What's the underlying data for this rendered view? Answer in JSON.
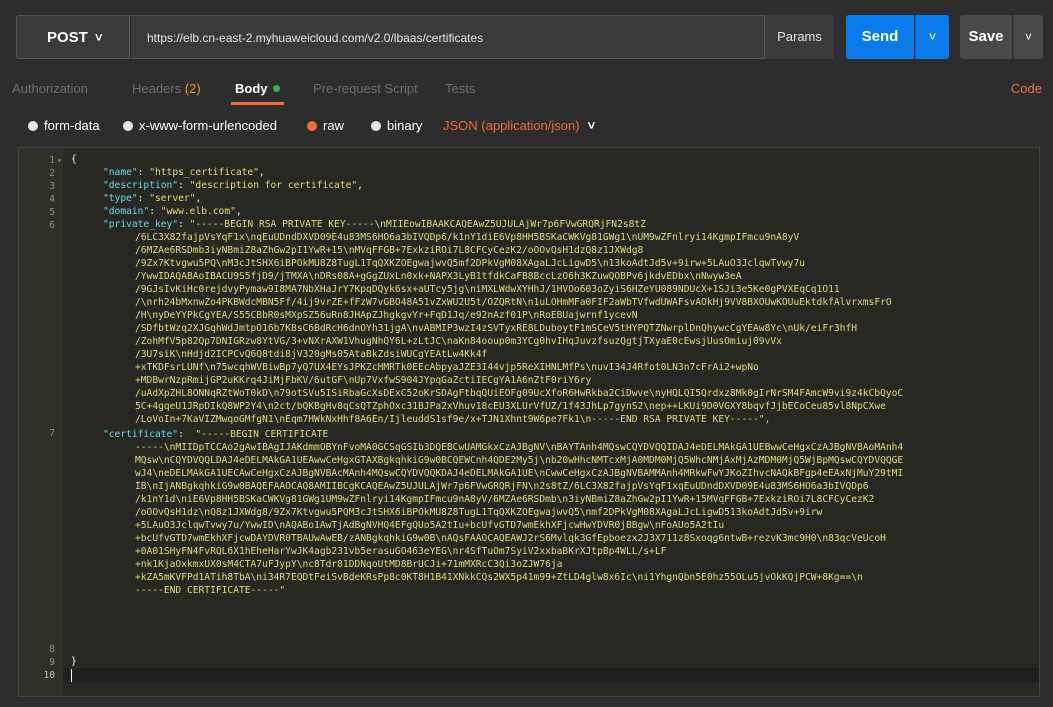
{
  "request": {
    "method": "POST",
    "url": "https://elb.cn-east-2.myhuaweicloud.com/v2.0/lbaas/certificates",
    "params_label": "Params",
    "send_label": "Send",
    "save_label": "Save"
  },
  "tabs": {
    "authorization": "Authorization",
    "headers": "Headers",
    "headers_count": "(2)",
    "body": "Body",
    "prerequest": "Pre-request Script",
    "tests": "Tests",
    "code": "Code"
  },
  "body_types": {
    "form_data": "form-data",
    "urlencoded": "x-www-form-urlencoded",
    "raw": "raw",
    "binary": "binary",
    "content_type": "JSON (application/json)"
  },
  "editor": {
    "line_numbers": [
      "1",
      "2",
      "3",
      "4",
      "5",
      "6",
      "7",
      "8",
      "9",
      "10"
    ],
    "open_brace": "{",
    "close_brace": "}",
    "name_key": "\"name\"",
    "name_val": "\"https_certificate\"",
    "desc_key": "\"description\"",
    "desc_val": "\"description for certificate\"",
    "type_key": "\"type\"",
    "type_val": "\"server\"",
    "domain_key": "\"domain\"",
    "domain_val": "\"www.elb.com\"",
    "pk_key": "\"private_key\"",
    "pk_lines": [
      "\"-----BEGIN RSA PRIVATE KEY-----\\nMIIEowIBAAKCAQEAwZ5UJULAjWr7p6FVwGRQRjFN2s8tZ",
      "/6LC3X82fajpVsYqF1x\\nqEuUDndDXVD09E4u83MS6HO6a3bIVQDp6/k1nY1diE6Vp8HH5BSKaCWKVg81GWg1\\nUM9wZFnlryi14KgmpIFmcu9nA8yV",
      "/6MZAe6RSDmb3iyNBmiZ8aZhGw2pI1YwR+15\\nMVqFFGB+7ExkziROi7L8CFCyCezK2/oOOvQsH1dzQ8z1JXWdg8",
      "/9Zx7Ktvgwu5PQ\\nM3cJtSHX6iBPOkMU8Z8TugL1TqQXKZOEgwajwvQ5mf2DPkVgM08XAgaLJcLigwD5\\n13koAdtJd5v+9irw+5LAuO3JclqwTvwy7u",
      "/YwwIDAQABAoIBACU9S5fjD9/jTMXA\\nDRs08A+gGgZUxLn0xk+NAPX3LyB1tfdkCaFB8BccLzO6h3KZuwQOBPv6jkdvEDbx\\nNwyw3eA",
      "/9GJsIvKiHc0rejdvyPymaw9I8MA7NbXHaJrY7KpqDQyk6sx+aUTcy5jg\\niMXLWdwXYHhJ/1HVOo603oZyiS6HZeYU089NDUcX+1SJi3e5Ke0gPVXEqCq1O11",
      "/\\nrh24bMxnwZo4PKBWdcMBN5Ff/4ij9vrZE+fFzW7vGBO48A51vZxWU2U5t/OZQRtN\\n1uLOHmMFa0FIF2aWbTVfwdUWAFsvAOkHj9VV8BXOUwKOUuEktdkfAlvrxmsFrO",
      "/H\\nyDeYYPkCgYEA/S55CBbR0sMXpSZ56uRn8JHApZJhgkgvYr+FqD1Jq/e92nAzf01P\\nRoEBUajwrnf1ycevN",
      "/SDfbtWzq2XJGqhWdJmtpO16b7KBsC6BdRcH6dnOYh31jgA\\nvABMIP3wzI4zSVTyxRE8LDuboytF1mSCeV5tHYPQTZNwrplDnQhywcCgYEAw8Yc\\nUk/eiFr3hfH",
      "/ZohMfV5p82Qp7DNIGRzw8YtVG/3+vNXrAXW1VhugNhQY6L+zLtJC\\naKn84ooup0m3YCg0hvIHqJuvzfsuzQgtjTXyaE0cEwsjUusOmiuj09vVx",
      "/3U7siK\\nHdjd2ICPCvQ6Q8tdi8jV320gMs05AtaBkZdsiWUCgYEAtLw4Kk4f",
      "+xTKDFsrLUNf\\n75wcqhWVBiwBp7yQ7UX4EYsJPKZcHMRTk0EEcAbpyaJZE3I44vjp5ReXIHNLMfPs\\nuvI34J4Rfot0LN3n7cFrAi2+wpNo",
      "+MDBwrNzpRmijGP2uKKrq4JiMjFbKV/6utGF\\nUp7VxfwS904JYpqGaZctiIECgYA1A6nZtF0riY6ry",
      "/uAdXpZHL8ONNqRZtWoT0kD\\n79otSVu5ISiRbaGcXsDExC52oKrSDAgFtbqQUiEOFg09UcXfoR6HwRkba2CiDwve\\nyHQLQI5Qrdxz8Mk0gIrNrSM4FAmcW9vi9z4kCbQyoC",
      "5C+4gqeU1JRpDIkQ8WP2Y4\\n2ct/bQKBgHv8qCsQTZphOxc31BJPa2xVhuv18cEU3XLUrVfUZ/1f43JhLp7gynS2\\nep++LKUi9D0VGXY8bqvfJjbECoCeu85vl8NpCXwe",
      "/LoVoIn+7KaVIZMwqoGMfgN1\\nEqm7HWkNxHhf8A6En/IjleuddS1sf9e/x+TJN1Xhnt9W6pe7Fk1\\n-----END RSA PRIVATE KEY-----\","
    ],
    "cert_key": "\"certificate\"",
    "cert_lines": [
      "\"-----BEGIN CERTIFICATE",
      "-----\\nMIIDpTCCAo2gAwIBAgIJAKdmmOBYnFvoMA0GCSqGSIb3DQEBCwUAMGkxCzAJBgNV\\nBAYTAnh4MQswCQYDVQQIDAJ4eDELMAkGA1UEBwwCeHgxCzAJBgNVBAoMAnh4",
      "MQsw\\nCQYDVQQLDAJ4eDELMAkGA1UEAwwCeHgxGTAXBgkqhkiG9w0BCQEWCnh4QDE2My5j\\nb20wHhcNMTcxMjA0MDM0MjQ5WhcNMjAxMjAzMDM0MjQ5WjBpMQswCQYDVQQGE",
      "wJ4\\neDELMAkGA1UECAwCeHgxCzAJBgNVBAcMAnh4MQswCQYDVQQKDAJ4eDELMAkGA1UE\\nCwwCeHgxCzAJBgNVBAMMAnh4MRkwFwYJKoZIhvcNAQkBFgp4eEAxNjMuY29tMI",
      "IB\\nIjANBgkqhkiG9w0BAQEFAAOCAQ8AMIIBCgKCAQEAwZ5UJULAjWr7p6FVwGRQRjFN\\n2s8tZ/6LC3X82fajpVsYqF1xqEuUDndDXVD09E4u83MS6HO6a3bIVQDp6",
      "/k1nY1d\\niE6Vp8HH5BSKaCWKVg81GWg1UM9wZFnlryi14KgmpIFmcu9nA8yV/6MZAe6RSDmb\\n3iyNBmiZ8aZhGw2pI1YwR+15MVqFFGB+7ExkziROi7L8CFCyCezK2",
      "/oOOvQsH1dz\\nQ8z1JXWdg8/9Zx7Ktvgwu5PQM3cJtSHX6iBPOkMU8Z8TugL1TqQXKZOEgwajwvQ5\\nmf2DPkVgM08XAgaLJcLigwD513koAdtJd5v+9irw",
      "+5LAuO3JclqwTvwy7u/YwwID\\nAQABo1AwTjAdBgNVHQ4EFgQUo5A2tIu+bcUfvGTD7wmEkhXFjcwHwYDVR0jBBgw\\nFoAUo5A2tIu",
      "+bcUfvGTD7wmEkhXFjcwDAYDVR0TBAUwAwEB/zANBgkqhkiG9w0B\\nAQsFAAOCAQEAWJ2rS6Mvlqk3GfEpboezx2J3X711z8Sxoqg6ntwB+rezvK3mc9H0\\n83qcVeUcoH",
      "+0A01SHyFN4FvRQL6X1hEheHarYwJK4agb231vb5erasuGO463eYEG\\nr4SfTuOm7SyiV2xxbaBKrXJtpBp4WLL/s+LF",
      "+nk1KjaOxkmxUX0sM4CTA7uFJypY\\nc8Tdr81DDNqoUtMD8BrUCJi+71mMXRcC3Qi3oZJW76ja",
      "+kZA5mKVFPd1ATih8TbA\\ni34R7EQDtFeiSvBdeKRsPp8c0KT8H1B41XNkkCQs2WX5p41m99+ZtLD4glw8x6Ic\\ni1YhgnQbn5E0hz55OLu5jvOkKQjPCW+8Kg==\\n",
      "-----END CERTIFICATE-----\""
    ]
  }
}
